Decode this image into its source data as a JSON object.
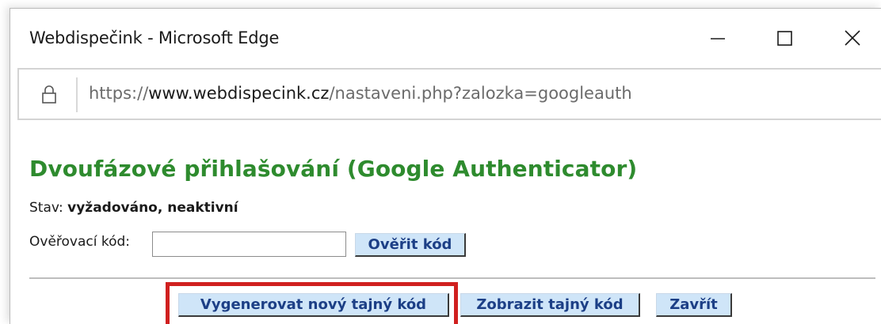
{
  "window": {
    "title": "Webdispečink - Microsoft Edge",
    "icons": {
      "minimize": "minimize-icon",
      "maximize": "maximize-icon",
      "close": "close-icon"
    }
  },
  "addressbar": {
    "lock_icon": "lock-icon",
    "scheme": "https://",
    "host": "www.webdispecink.cz",
    "path": "/nastaveni.php?zalozka=googleauth"
  },
  "page": {
    "heading": "Dvoufázové přihlašování (Google Authenticator)",
    "status_label": "Stav: ",
    "status_value": "vyžadováno, neaktivní",
    "code_label": "Ověřovací kód:",
    "code_value": "",
    "verify_button": "Ověřit kód",
    "generate_button": "Vygenerovat nový tajný kód",
    "show_button": "Zobrazit tajný kód",
    "close_button": "Zavřít"
  },
  "colors": {
    "heading": "#2e8b2e",
    "button_bg": "#cfe5f8",
    "button_text": "#1c3f86",
    "highlight": "#d0201f"
  }
}
